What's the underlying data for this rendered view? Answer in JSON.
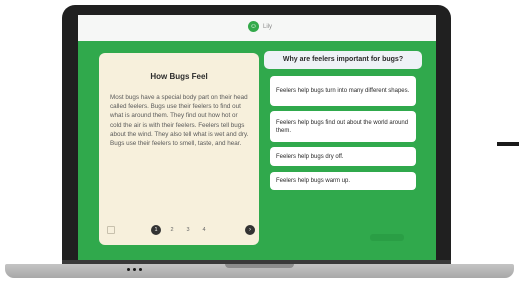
{
  "app": {
    "brand_name": "Lily",
    "accent_color": "#30a94c"
  },
  "reading": {
    "title": "How Bugs Feel",
    "body": "Most bugs have a special body part on their head called feelers. Bugs use their feelers to find out what is around them. They find out how hot or cold the air is with their feelers. Feelers tell bugs about the wind. They also tell what is wet and dry. Bugs use their feelers to smell, taste, and hear.",
    "pages": [
      "1",
      "2",
      "3",
      "4"
    ],
    "current_page": "1",
    "bookmark_icon": "bookmark-icon",
    "next_icon": "chevron-right-icon"
  },
  "question": {
    "text": "Why are feelers important for bugs?",
    "answers": [
      "Feelers help bugs turn into many different shapes.",
      "Feelers help bugs find out about the world around them.",
      "Feelers help bugs dry off.",
      "Feelers help bugs warm up."
    ]
  }
}
